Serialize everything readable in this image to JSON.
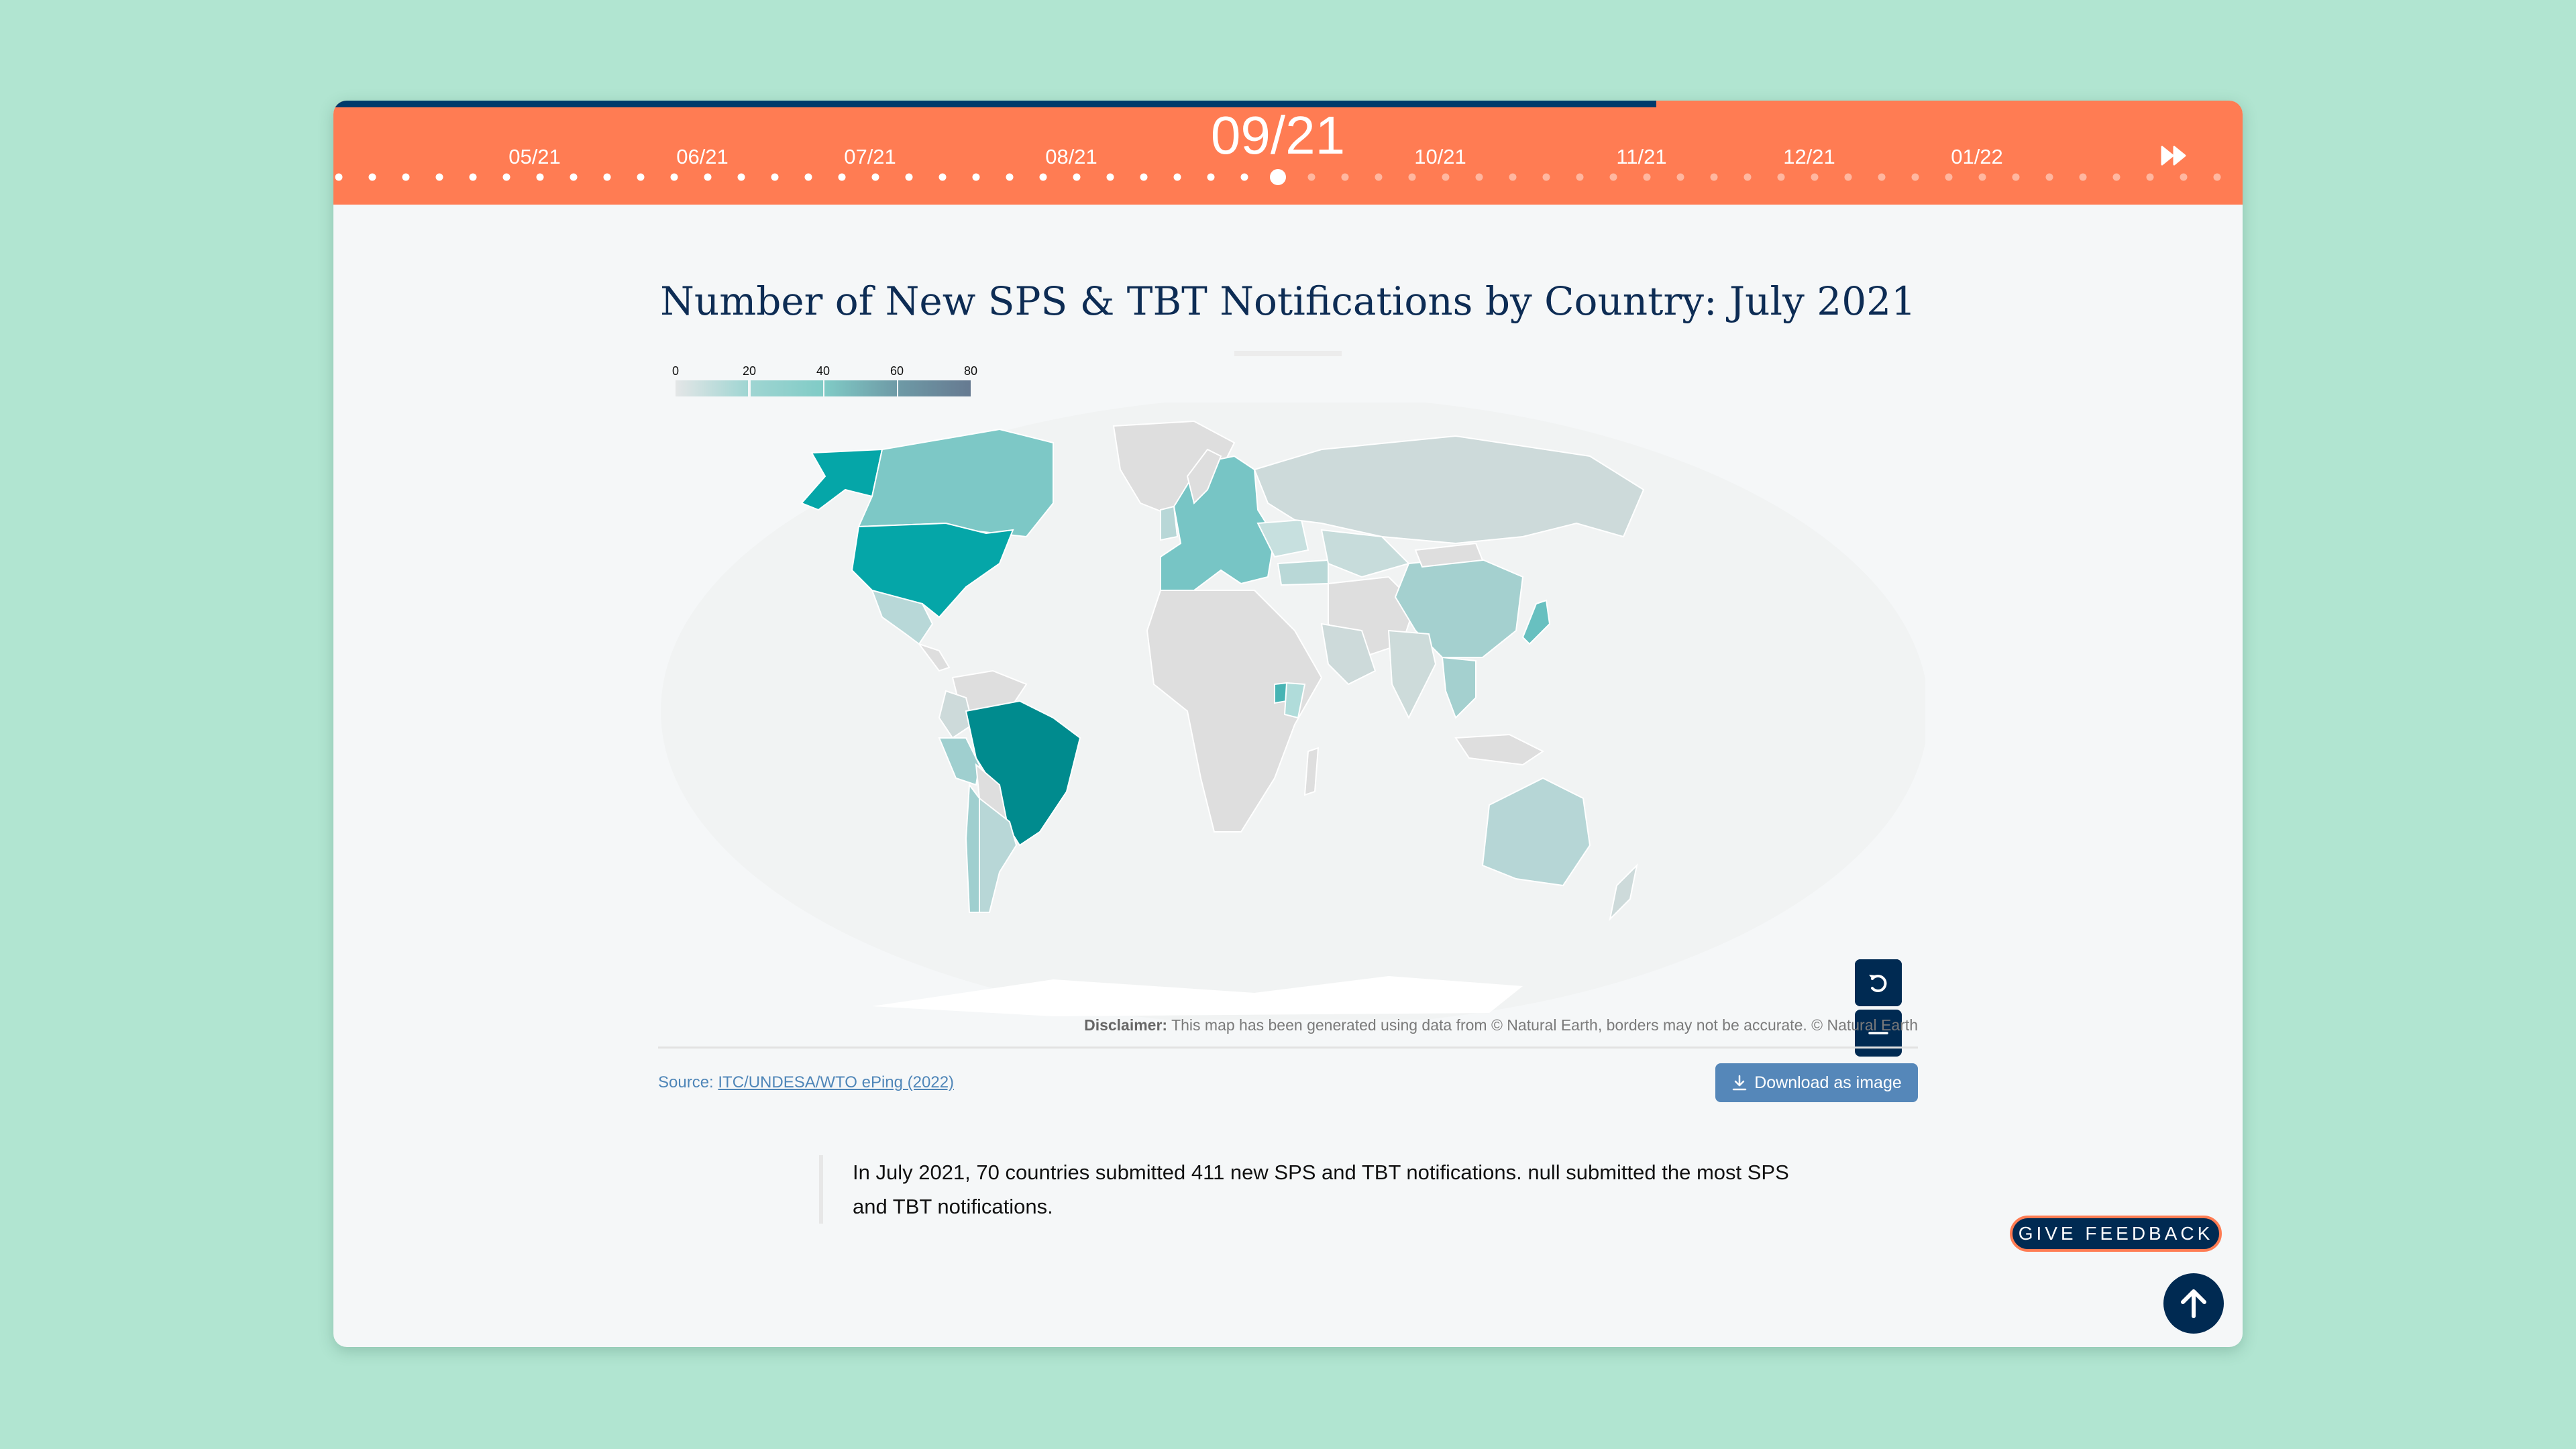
{
  "timeline": {
    "progress_fraction": 0.693,
    "months": [
      {
        "label": "05/21",
        "dot_index": 6
      },
      {
        "label": "06/21",
        "dot_index": 11
      },
      {
        "label": "07/21",
        "dot_index": 16
      },
      {
        "label": "08/21",
        "dot_index": 22
      },
      {
        "label": "10/21",
        "dot_index": 33
      },
      {
        "label": "11/21",
        "dot_index": 39
      },
      {
        "label": "12/21",
        "dot_index": 44
      },
      {
        "label": "01/22",
        "dot_index": 49
      }
    ],
    "current_label": "09/21",
    "current_dot_index": 28,
    "dot_count": 57,
    "fast_forward_icon": "fast-forward-icon"
  },
  "chart": {
    "title": "Number of New SPS & TBT Notifications by Country: July 2021",
    "disclaimer_label": "Disclaimer:",
    "disclaimer_text": " This map has been generated using data from © Natural Earth, borders may not be accurate. © Natural Earth",
    "source_label": "Source: ",
    "source_link": "ITC/UNDESA/WTO ePing (2022)",
    "download_label": "Download as image",
    "zoom_in_icon": "plus-icon",
    "zoom_out_icon": "minus-icon",
    "reset_icon": "reset-icon"
  },
  "chart_data": {
    "type": "choropleth",
    "title": "Number of New SPS & TBT Notifications by Country: July 2021",
    "legend": {
      "ticks": [
        "0",
        "20",
        "40",
        "60",
        "80"
      ],
      "range": [
        0,
        80
      ],
      "colors": [
        "#e4e6e7",
        "#9fd5d2",
        "#80cbc6",
        "#6e9aa6",
        "#667a91"
      ]
    },
    "no_data_color": "#dedede",
    "regions": [
      {
        "name": "Brazil",
        "value_band": "60-80",
        "color": "#008b8e"
      },
      {
        "name": "United States",
        "value_band": "40-60",
        "color": "#05a6a8"
      },
      {
        "name": "Canada",
        "value_band": "20-40",
        "color": "#7dc8c6"
      },
      {
        "name": "European Union",
        "value_band": "20-40",
        "color": "#77c5c5"
      },
      {
        "name": "Uganda",
        "value_band": "20-40",
        "color": "#47b4b4"
      },
      {
        "name": "Japan",
        "value_band": "20-40",
        "color": "#68c0c0"
      },
      {
        "name": "China",
        "value_band": "0-20",
        "color": "#a4d0cf"
      },
      {
        "name": "Russia",
        "value_band": "0-20",
        "color": "#cddada"
      },
      {
        "name": "Australia",
        "value_band": "0-20",
        "color": "#b6d6d6"
      },
      {
        "name": "Kenya",
        "value_band": "0-20",
        "color": "#b0dcda"
      },
      {
        "name": "Argentina",
        "value_band": "0-20",
        "color": "#b8d7d7"
      },
      {
        "name": "Peru",
        "value_band": "0-20",
        "color": "#9fcfcf"
      },
      {
        "name": "Mexico",
        "value_band": "0-20",
        "color": "#b8d8d8"
      },
      {
        "name": "India",
        "value_band": "0-20",
        "color": "#cddbda"
      }
    ]
  },
  "summary": {
    "text": "In July 2021, 70 countries submitted 411 new SPS and TBT notifications. null submitted the most SPS and TBT notifications."
  },
  "actions": {
    "feedback_label": "GIVE FEEDBACK",
    "back_to_top_icon": "arrow-up-icon"
  }
}
